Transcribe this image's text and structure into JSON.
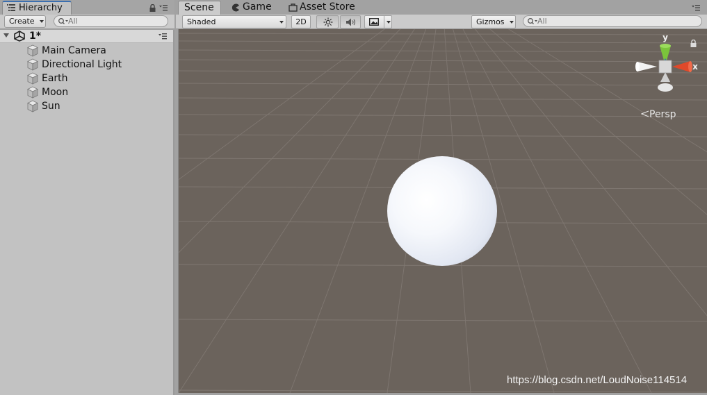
{
  "hierarchy": {
    "tab_label": "Hierarchy",
    "create_label": "Create",
    "search_placeholder": "All",
    "scene_name": "1*",
    "items": [
      {
        "label": "Main Camera"
      },
      {
        "label": "Directional Light"
      },
      {
        "label": "Earth"
      },
      {
        "label": "Moon"
      },
      {
        "label": "Sun"
      }
    ]
  },
  "scene": {
    "tabs": [
      {
        "label": "Scene",
        "active": true
      },
      {
        "label": "Game",
        "icon": "pacman-icon"
      },
      {
        "label": "Asset Store",
        "icon": "bag-icon"
      }
    ],
    "draw_mode": "Shaded",
    "mode_2d_label": "2D",
    "gizmos_label": "Gizmos",
    "search_placeholder": "All",
    "axis_y": "y",
    "axis_x": "x",
    "projection_label": "Persp",
    "watermark": "https://blog.csdn.net/LoudNoise114514"
  },
  "colors": {
    "viewport_bg": "#6b635c",
    "axis_x": "#e0492a",
    "axis_y": "#7bc43b",
    "axis_z": "#3b6fb0",
    "tab_accent": "#3b6fb0"
  }
}
